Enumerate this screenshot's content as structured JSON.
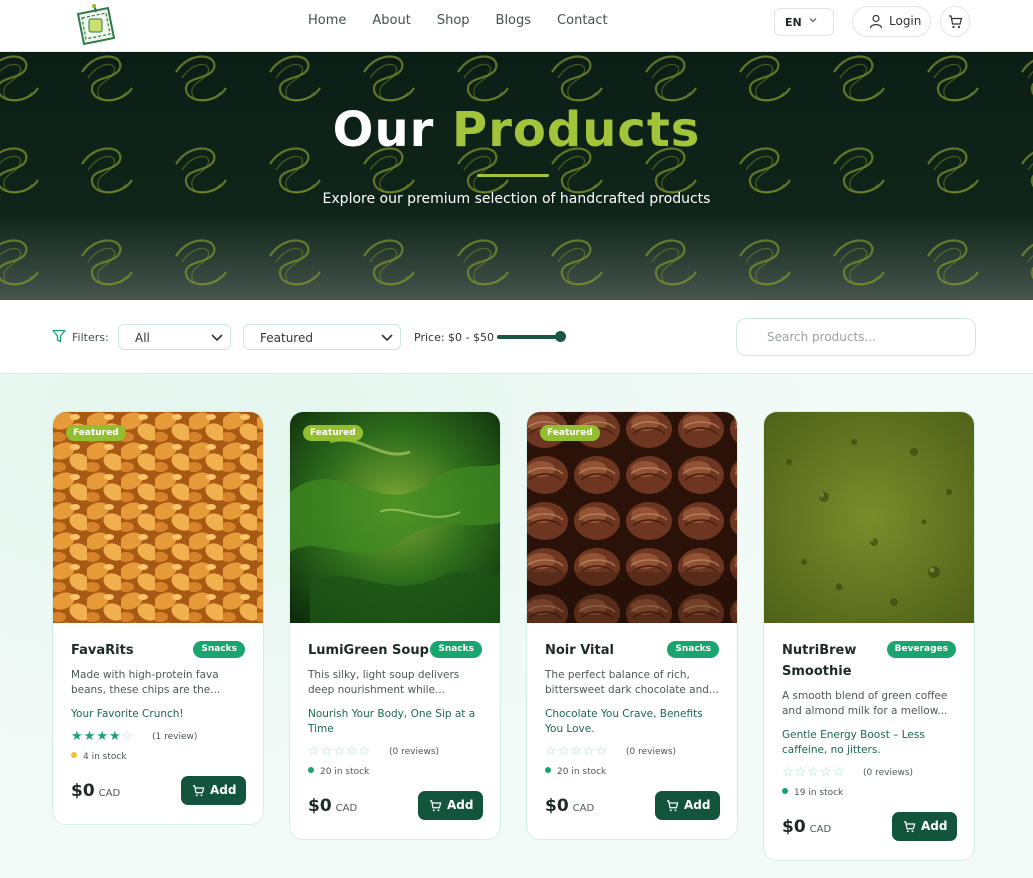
{
  "header": {
    "nav": [
      "Home",
      "About",
      "Shop",
      "Blogs",
      "Contact"
    ],
    "lang": "EN",
    "login": "Login",
    "icons": [
      "logo",
      "chevron-down-icon",
      "user-icon",
      "cart-icon"
    ]
  },
  "hero": {
    "title_a": "Our",
    "title_b": "Products",
    "subtitle": "Explore our premium selection of handcrafted products"
  },
  "filters": {
    "label": "Filters:",
    "category": "All",
    "sort": "Featured",
    "price_label": "Price: $0 - $50",
    "price_max": 50,
    "slider_fraction": 1.0,
    "search_placeholder": "Search products..."
  },
  "colors": {
    "accent": "#a3c43a",
    "primary": "#13543c",
    "badge": "#18a66e"
  },
  "products": [
    {
      "featured": "Featured",
      "name": "FavaRits",
      "category": "Snacks",
      "description": "Made with high-protein fava beans, these chips are the...",
      "tagline": "Your Favorite Crunch!",
      "rating": 4,
      "reviews": "(1 review)",
      "stock": "4 in stock",
      "stock_color": "#f2c12e",
      "price": "$0",
      "currency": "CAD",
      "add": "Add"
    },
    {
      "featured": "Featured",
      "name": "LumiGreen Soup",
      "category": "Snacks",
      "description": "This silky, light soup delivers deep nourishment while...",
      "tagline": "Nourish Your Body, One Sip at a Time",
      "rating": 0,
      "reviews": "(0 reviews)",
      "stock": "20 in stock",
      "stock_color": "#1aa36b",
      "price": "$0",
      "currency": "CAD",
      "add": "Add"
    },
    {
      "featured": "Featured",
      "name": "Noir Vital",
      "category": "Snacks",
      "description": "The perfect balance of rich, bittersweet dark chocolate and...",
      "tagline": "Chocolate You Crave, Benefits You Love.",
      "rating": 0,
      "reviews": "(0 reviews)",
      "stock": "20 in stock",
      "stock_color": "#1aa36b",
      "price": "$0",
      "currency": "CAD",
      "add": "Add"
    },
    {
      "name": "NutriBrew Smoothie",
      "category": "Beverages",
      "description": "A smooth blend of green coffee and almond milk for a mellow...",
      "tagline": "Gentle Energy Boost – Less caffeine, no jitters.",
      "rating": 0,
      "reviews": "(0 reviews)",
      "stock": "19 in stock",
      "stock_color": "#1aa36b",
      "price": "$0",
      "currency": "CAD",
      "add": "Add"
    }
  ]
}
